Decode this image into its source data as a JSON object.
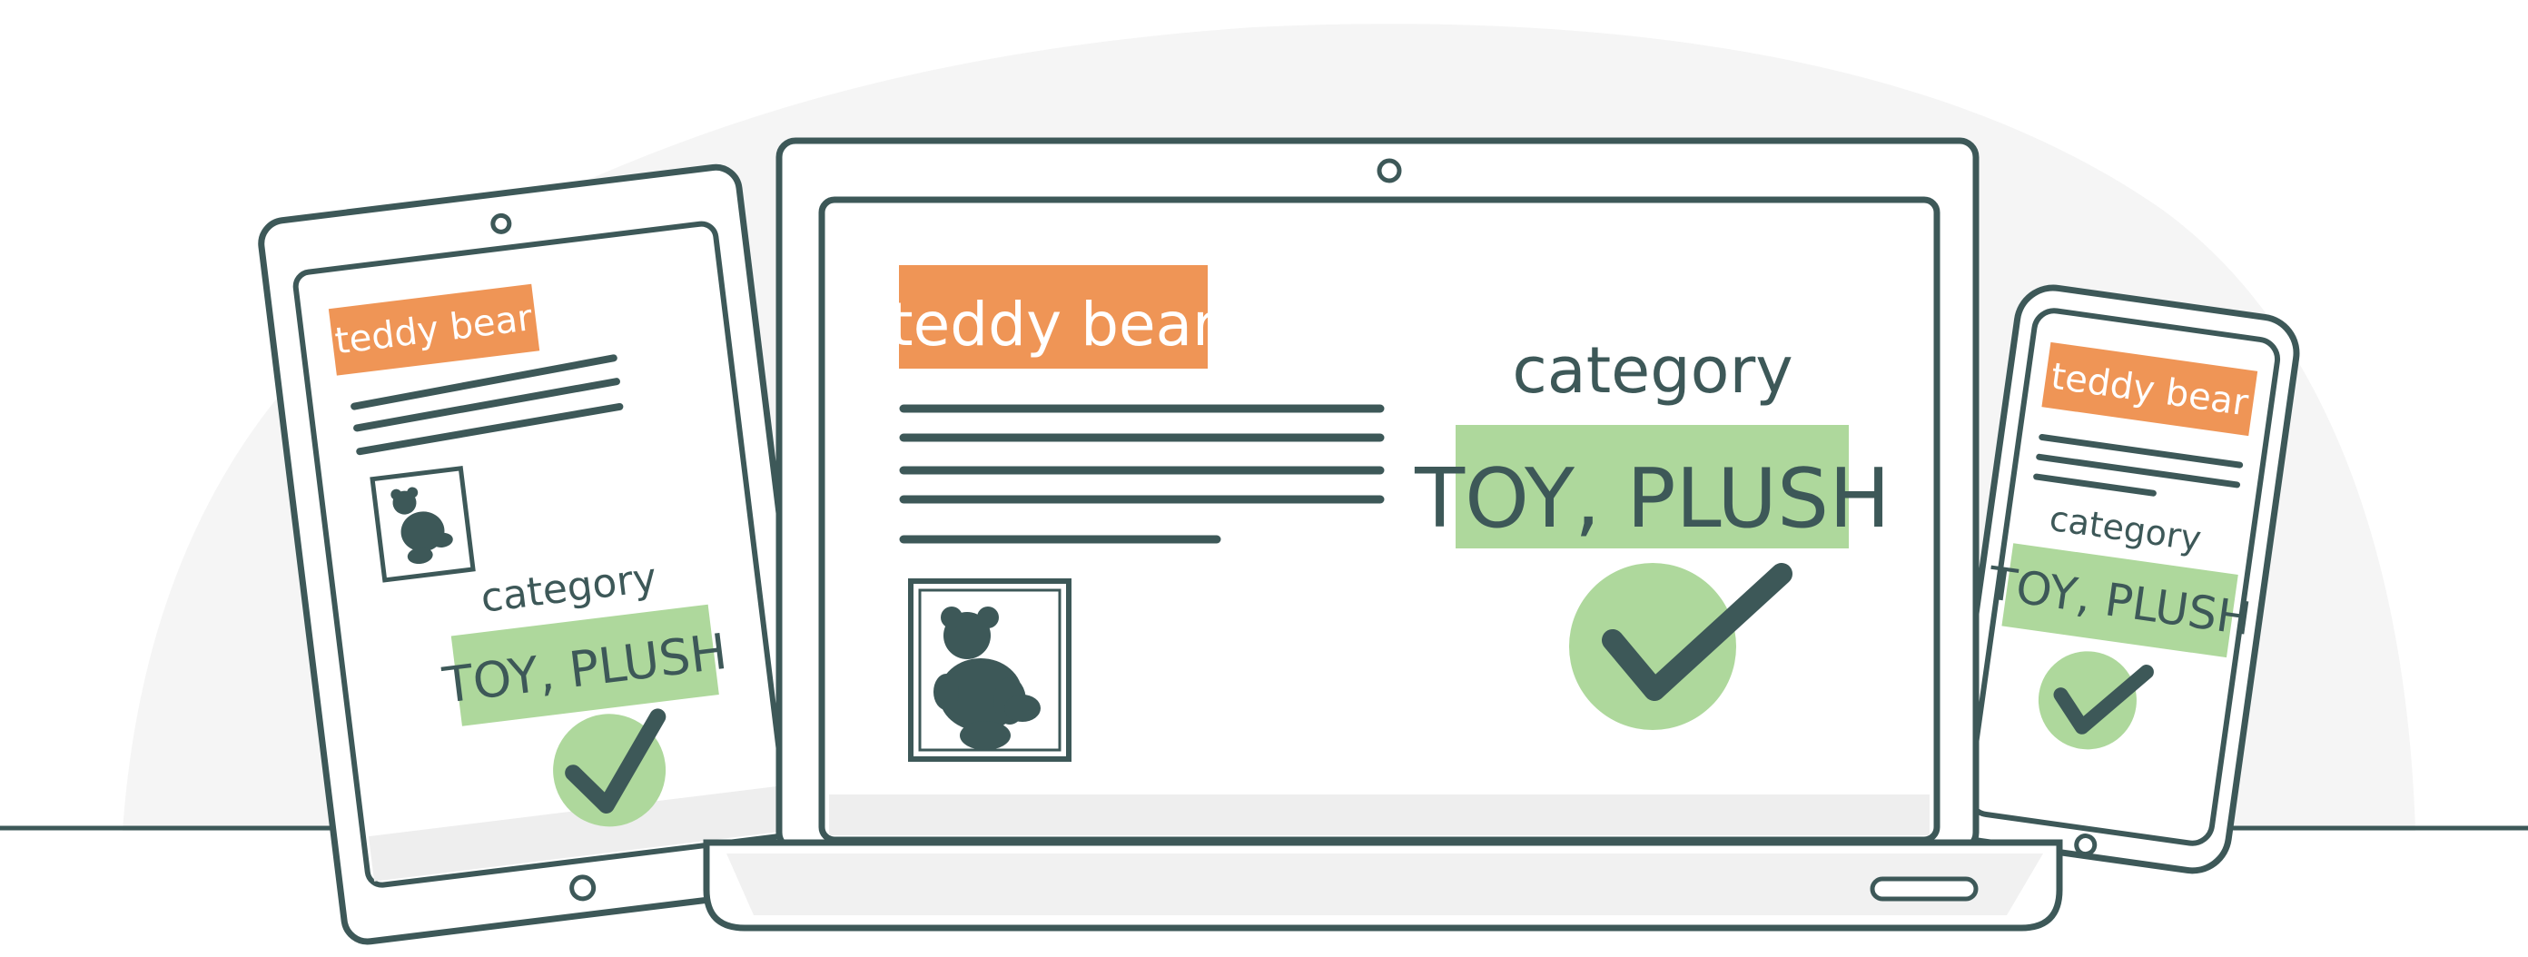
{
  "colors": {
    "ink": "#3d5858",
    "orange": "#ef9556",
    "green": "#aed89c",
    "bg_blob": "#f5f5f5",
    "device_fill": "#ffffff",
    "screen_shade": "#eeeeee"
  },
  "laptop": {
    "product_tag": "teddy bear",
    "category_label": "category",
    "category_value": "TOY, PLUSH",
    "check_icon": "checkmark-icon",
    "image_icon": "teddy-bear-icon"
  },
  "tablet": {
    "product_tag": "teddy bear",
    "category_label": "category",
    "category_value": "TOY, PLUSH",
    "check_icon": "checkmark-icon",
    "image_icon": "teddy-bear-icon"
  },
  "phone": {
    "product_tag": "teddy bear",
    "category_label": "category",
    "category_value": "TOY, PLUSH",
    "check_icon": "checkmark-icon"
  }
}
